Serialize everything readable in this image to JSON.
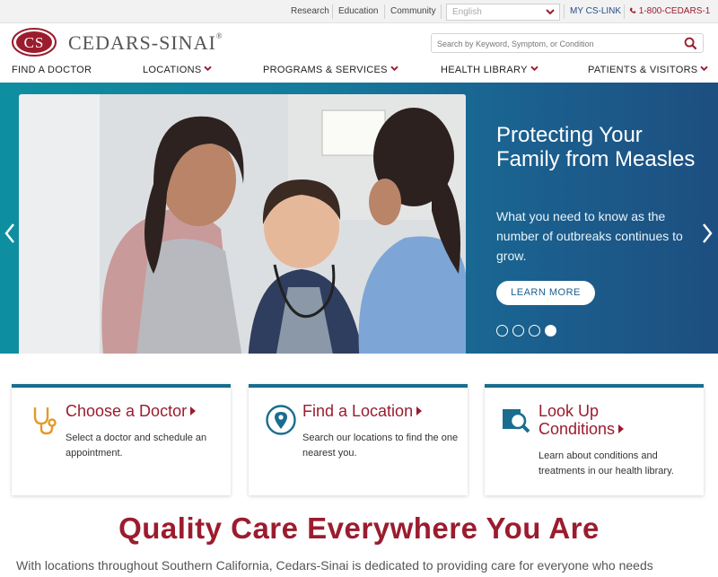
{
  "utility": {
    "research": "Research",
    "education": "Education",
    "community": "Community",
    "language": "English",
    "my_cs_link": "MY CS-LINK",
    "phone": "1-800-CEDARS-1"
  },
  "header": {
    "logo_seal": "CS",
    "logo_text": "CEDARS-SINAI",
    "logo_reg": "®",
    "search_placeholder": "Search by Keyword, Symptom, or Condition"
  },
  "nav": {
    "find_doctor": "FIND A DOCTOR",
    "locations": "LOCATIONS",
    "programs": "PROGRAMS & SERVICES",
    "health_library": "HEALTH LIBRARY",
    "patients": "PATIENTS & VISITORS"
  },
  "hero": {
    "title": "Protecting Your Family from Measles",
    "text": "What you need to know as the number of outbreaks continues to grow.",
    "button": "LEARN MORE",
    "slide_count": 4,
    "active_slide": 4
  },
  "cards": [
    {
      "title": "Choose a Doctor",
      "text": "Select a doctor and schedule an appointment.",
      "icon": "stethoscope-icon"
    },
    {
      "title": "Find a Location",
      "text": "Search our locations to find the one nearest you.",
      "icon": "location-pin-icon"
    },
    {
      "title_line1": "Look Up",
      "title_line2": "Conditions",
      "text": "Learn about conditions and treatments in our health library.",
      "icon": "magnifier-document-icon"
    }
  ],
  "section": {
    "heading": "Quality Care Everywhere You Are",
    "intro": "With locations throughout Southern California, Cedars-Sinai is dedicated to providing care for everyone who needs"
  },
  "colors": {
    "brand_red": "#9b1c2e",
    "teal": "#0e8fa0",
    "navy": "#1d4f80"
  }
}
